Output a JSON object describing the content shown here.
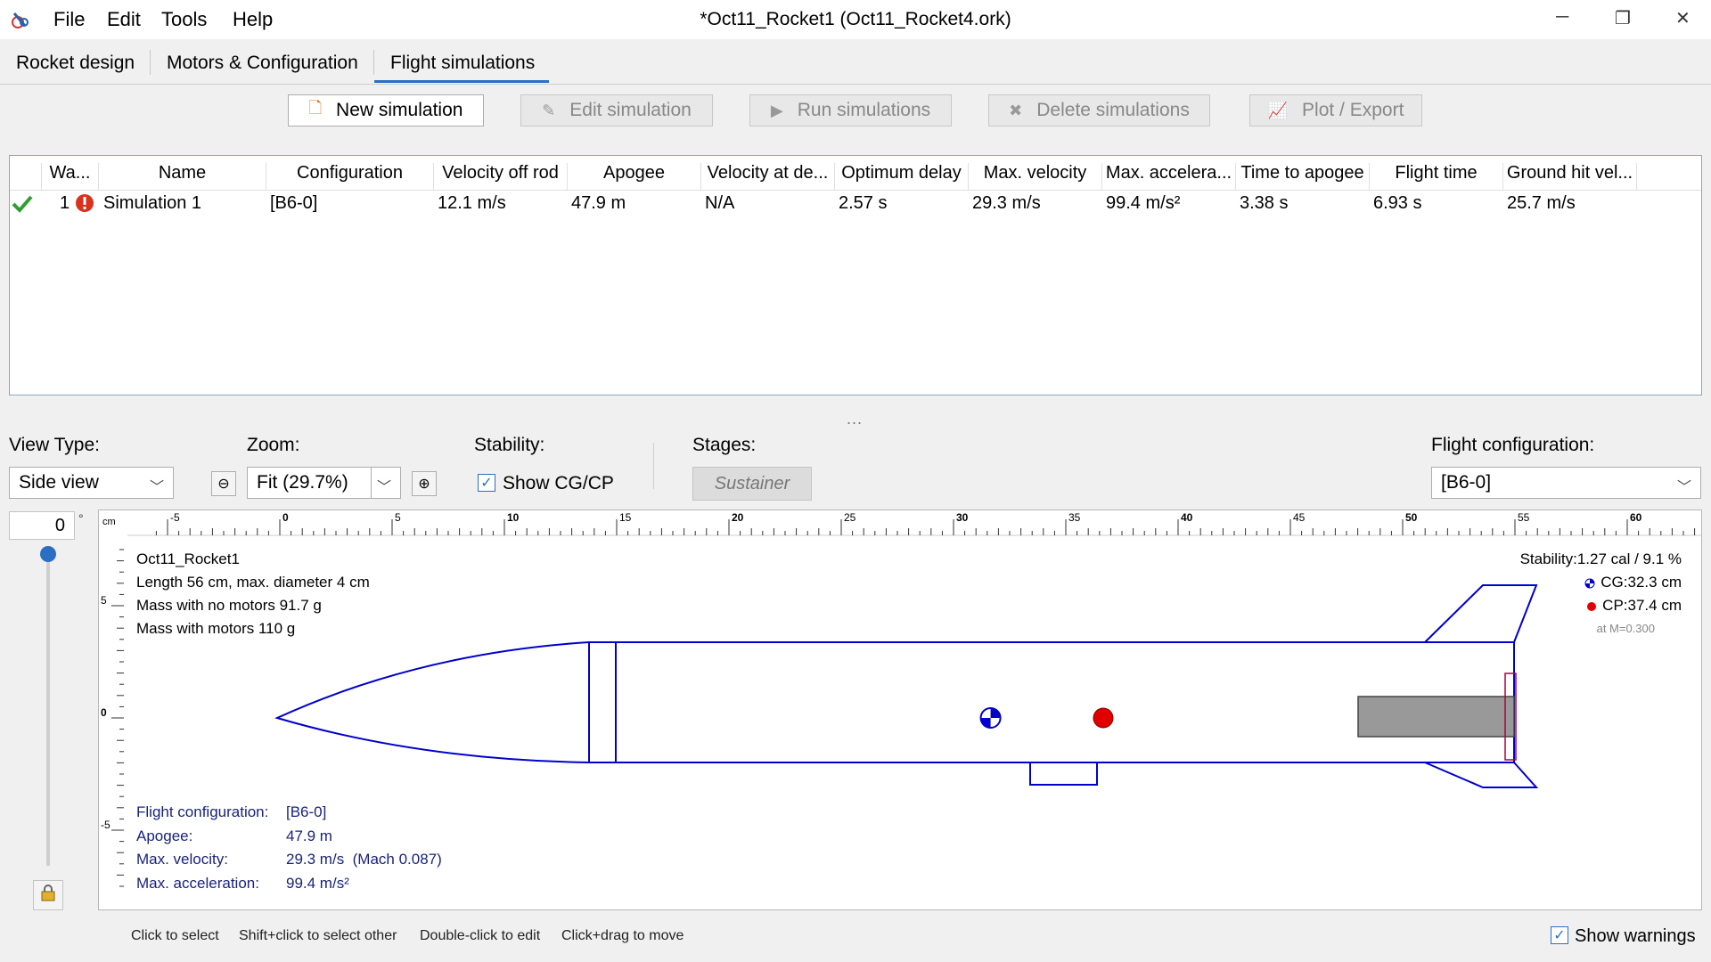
{
  "window": {
    "title": "*Oct11_Rocket1 (Oct11_Rocket4.ork)",
    "menu": [
      "File",
      "Edit",
      "Tools",
      "Help"
    ],
    "app_icon": "openrocket-icon",
    "controls": {
      "minimize": "─",
      "restore": "❐",
      "close": "✕"
    }
  },
  "tabs": [
    {
      "label": "Rocket design",
      "active": false
    },
    {
      "label": "Motors & Configuration",
      "active": false
    },
    {
      "label": "Flight simulations",
      "active": true
    }
  ],
  "toolbar": {
    "new_simulation": "New simulation",
    "edit_simulation": "Edit simulation",
    "run_simulations": "Run simulations",
    "delete_simulations": "Delete simulations",
    "plot_export": "Plot / Export"
  },
  "table": {
    "columns": [
      "Wa...",
      "Name",
      "Configuration",
      "Velocity off rod",
      "Apogee",
      "Velocity at de...",
      "Optimum delay",
      "Max. velocity",
      "Max. accelera...",
      "Time to apogee",
      "Flight time",
      "Ground hit vel..."
    ],
    "rows": [
      {
        "status": "up-to-date",
        "warnings": "1",
        "name": "Simulation 1",
        "configuration": "[B6-0]",
        "velocity_off_rod": "12.1 m/s",
        "apogee": "47.9 m",
        "velocity_at_deployment": "N/A",
        "optimum_delay": "2.57 s",
        "max_velocity": "29.3 m/s",
        "max_acceleration": "99.4 m/s²",
        "time_to_apogee": "3.38 s",
        "flight_time": "6.93 s",
        "ground_hit_velocity": "25.7 m/s"
      }
    ]
  },
  "splitter": "...",
  "view": {
    "view_type_label": "View Type:",
    "view_type_value": "Side view",
    "zoom_label": "Zoom:",
    "zoom_value": "Fit (29.7%)",
    "stability_label": "Stability:",
    "show_cgcp_label": "Show CG/CP",
    "show_cgcp_checked": true,
    "stages_label": "Stages:",
    "stage_button": "Sustainer",
    "flight_config_label": "Flight configuration:",
    "flight_config_value": "[B6-0]",
    "rotation_value": "0",
    "rotation_unit": "°"
  },
  "ruler": {
    "unit": "cm",
    "h_labels": [
      "-5",
      "0",
      "5",
      "10",
      "15",
      "20",
      "25",
      "30",
      "35",
      "40",
      "45",
      "50",
      "55",
      "60"
    ],
    "v_labels": [
      "5",
      "0",
      "-5"
    ]
  },
  "rocket_info": {
    "name": "Oct11_Rocket1",
    "length": "Length 56 cm, max. diameter 4 cm",
    "mass_no_motors": "Mass with no motors 91.7 g",
    "mass_with_motors": "Mass with motors 110 g",
    "stability_label": "Stability:",
    "stability_value": "1.27 cal / 9.1 %",
    "cg_label": "CG:",
    "cg_value": "32.3 cm",
    "cp_label": "CP:",
    "cp_value": "37.4 cm",
    "mach_note": "at M=0.300",
    "cg_cm": 32.3,
    "cp_cm": 37.4,
    "length_cm": 56,
    "diameter_cm": 4
  },
  "flight_info": {
    "config_label": "Flight configuration:",
    "config_value": "[B6-0]",
    "apogee_label": "Apogee:",
    "apogee_value": "47.9 m",
    "max_velocity_label": "Max. velocity:",
    "max_velocity_value": "29.3 m/s  (Mach 0.087)",
    "max_accel_label": "Max. acceleration:",
    "max_accel_value": "99.4 m/s²"
  },
  "status_hints": [
    "Click to select",
    "Shift+click to select other",
    "Double-click to edit",
    "Click+drag to move"
  ],
  "show_warnings_label": "Show warnings",
  "show_warnings_checked": true,
  "colors": {
    "accent": "#2b6fc4",
    "rocket_outline": "#0000cc",
    "motor_fill": "#999999",
    "cp_red": "#e00000",
    "ok_green": "#2e9e2e",
    "warn_red": "#d9321f"
  }
}
